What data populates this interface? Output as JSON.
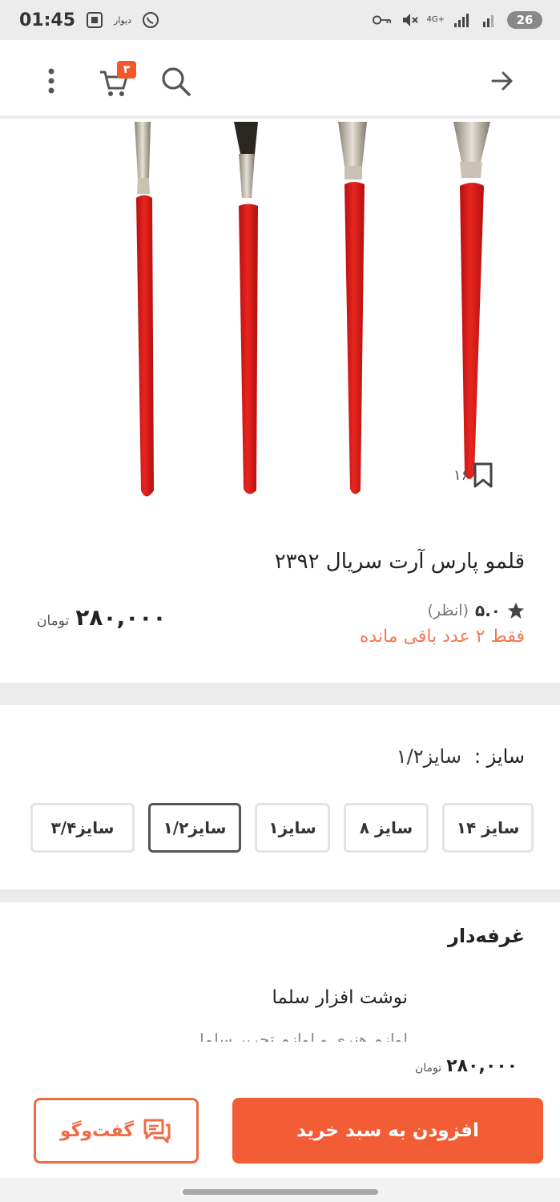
{
  "status_bar": {
    "time": "01:45",
    "divar_label": "دیوار",
    "network": "4G+",
    "battery": "26",
    "icons": [
      "screenshot-icon",
      "whatsapp-icon",
      "vpn-key-icon",
      "mute-icon",
      "signal-icon",
      "battery-icon"
    ]
  },
  "app_bar": {
    "cart_count": "۳",
    "icons": [
      "back-arrow-icon",
      "search-icon",
      "cart-icon",
      "more-vert-icon"
    ]
  },
  "product": {
    "bookmark_count": "۱۶",
    "title": "قلمو پارس آرت سریال ۲۳۹۲",
    "rating": "۵.۰",
    "rating_note": "(انظر)",
    "stock": "فقط ۲ عدد باقی مانده",
    "price": "۲۸۰,۰۰۰",
    "currency": "تومان"
  },
  "size_section": {
    "label": "سایز :",
    "selected": "سایز۱/۲",
    "options": [
      "سایز ۱۴",
      "سایز ۸",
      "سایز۱",
      "سایز۱/۲",
      "سایز۳/۴"
    ],
    "selected_index": 3
  },
  "seller": {
    "heading": "غرفه‌دار",
    "name": "نوشت افزار  سلما",
    "subtitle": "لوازم هنری و لوازم تحریر سلما"
  },
  "bottom_bar": {
    "price": "۲۸۰,۰۰۰",
    "currency": "تومان",
    "add_to_cart": "افزودن به سبد خرید",
    "chat": "گفت‌وگو"
  },
  "colors": {
    "accent": "#f35d35",
    "stock": "#f07a52",
    "brush_red": "#e0201e"
  }
}
